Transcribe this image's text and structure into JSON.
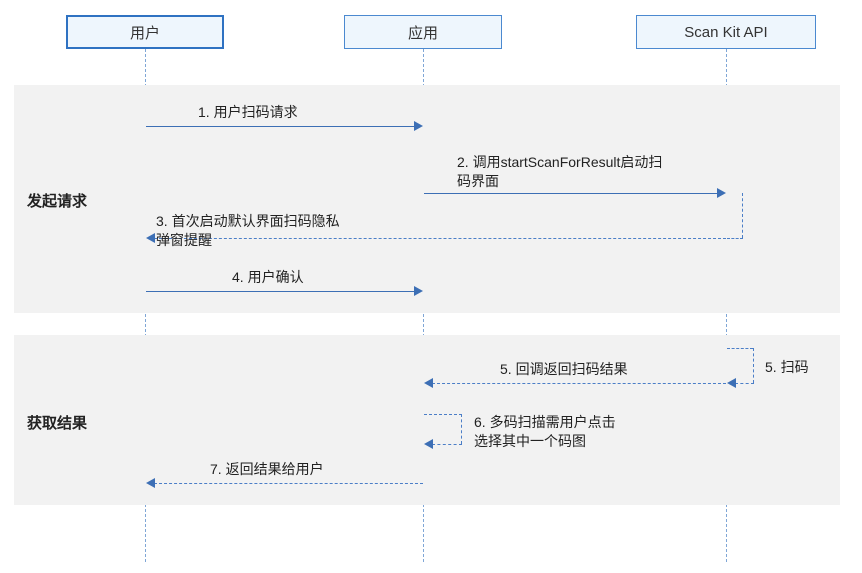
{
  "participants": {
    "user": "用户",
    "app": "应用",
    "api": "Scan Kit API"
  },
  "sections": {
    "request": "发起请求",
    "result": "获取结果"
  },
  "messages": {
    "m1": "1. 用户扫码请求",
    "m2": "2. 调用startScanForResult启动扫\n码界面",
    "m3": "3. 首次启动默认界面扫码隐私\n弹窗提醒",
    "m4": "4. 用户确认",
    "m5a": "5. 回调返回扫码结果",
    "m5b": "5. 扫码",
    "m6": "6. 多码扫描需用户点击\n选择其中一个码图",
    "m7": "7. 返回结果给用户"
  },
  "chart_data": {
    "type": "sequence-diagram",
    "participants": [
      "用户",
      "应用",
      "Scan Kit API"
    ],
    "groups": [
      {
        "label": "发起请求",
        "messages": [
          {
            "from": "用户",
            "to": "应用",
            "text": "1. 用户扫码请求",
            "style": "solid"
          },
          {
            "from": "应用",
            "to": "Scan Kit API",
            "text": "2. 调用startScanForResult启动扫码界面",
            "style": "solid"
          },
          {
            "from": "Scan Kit API",
            "to": "用户",
            "text": "3. 首次启动默认界面扫码隐私弹窗提醒",
            "style": "dashed"
          },
          {
            "from": "用户",
            "to": "应用",
            "text": "4. 用户确认",
            "style": "solid"
          }
        ]
      },
      {
        "label": "获取结果",
        "messages": [
          {
            "from": "Scan Kit API",
            "to": "Scan Kit API",
            "text": "5. 扫码",
            "style": "dashed",
            "self": true
          },
          {
            "from": "Scan Kit API",
            "to": "应用",
            "text": "5. 回调返回扫码结果",
            "style": "dashed"
          },
          {
            "from": "应用",
            "to": "应用",
            "text": "6. 多码扫描需用户点击选择其中一个码图",
            "style": "dashed",
            "self": true
          },
          {
            "from": "应用",
            "to": "用户",
            "text": "7. 返回结果给用户",
            "style": "dashed"
          }
        ]
      }
    ]
  }
}
